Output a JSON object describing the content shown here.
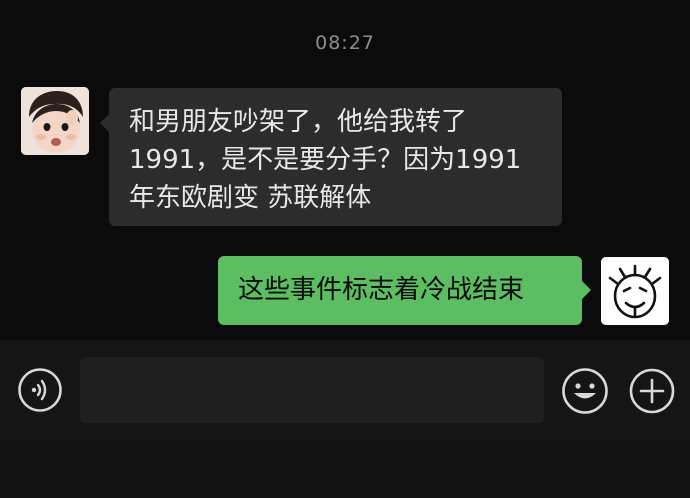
{
  "chat": {
    "timestamp": "08:27",
    "messages": [
      {
        "from": "other",
        "avatar": "toddler-photo-avatar",
        "text": "和男朋友吵架了，他给我转了\n1991，是不是要分手？因为1991\n年东欧剧变 苏联解体"
      },
      {
        "from": "self",
        "avatar": "cartoon-face-avatar",
        "text": "这些事件标志着冷战结束"
      }
    ]
  },
  "input_bar": {
    "voice_icon": "voice-icon",
    "text_value": "",
    "emoji_icon": "emoji-icon",
    "plus_icon": "plus-icon"
  },
  "colors": {
    "background": "#0b0b0b",
    "incoming_bubble": "#2c2c2c",
    "outgoing_bubble": "#5dbd62",
    "timestamp": "#8e8e8e"
  }
}
